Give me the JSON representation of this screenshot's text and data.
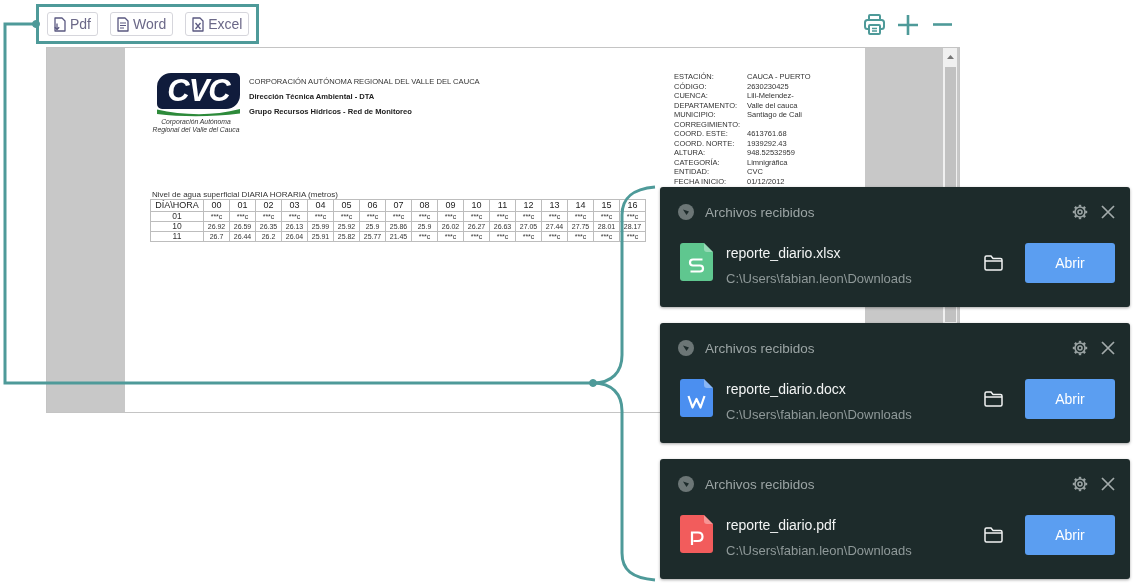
{
  "toolbar": {
    "buttons": [
      {
        "label": "Pdf",
        "kind": "pdf"
      },
      {
        "label": "Word",
        "kind": "word"
      },
      {
        "label": "Excel",
        "kind": "excel"
      }
    ]
  },
  "document": {
    "logo": {
      "wordmark": "CVC",
      "caption_lines": [
        "Corporación Autónoma",
        "Regional del Valle del Cauca"
      ]
    },
    "header_lines": [
      "CORPORACIÓN AUTÓNOMA REGIONAL DEL VALLE DEL CAUCA",
      "Dirección Técnica Ambiental - DTA",
      "Grupo Recursos Hídricos - Red de Monitoreo"
    ],
    "station_info": [
      {
        "label": "ESTACIÓN:",
        "value": "CAUCA - PUERTO"
      },
      {
        "label": "CÓDIGO:",
        "value": "2630230425"
      },
      {
        "label": "CUENCA:",
        "value": "Lili-Melendez-"
      },
      {
        "label": "DEPARTAMENTO:",
        "value": "Valle del cauca"
      },
      {
        "label": "MUNICIPIO:",
        "value": "Santiago de Cali"
      },
      {
        "label": "CORREGIMIENTO:"
      },
      {
        "label": "COORD. ESTE:",
        "value": "4613761.68"
      },
      {
        "label": "COORD. NORTE:",
        "value": "1939292.43"
      },
      {
        "label": "ALTURA:",
        "value": "948.52532959"
      },
      {
        "label": "CATEGORÍA:",
        "value": "Limnigráfica"
      },
      {
        "label": "ENTIDAD:",
        "value": "CVC"
      },
      {
        "label": "FECHA INICIO:",
        "value": "01/12/2012"
      }
    ],
    "table": {
      "caption": "Nivel de agua superficial DIARIA HORARIA (metros)",
      "columns": [
        "DÍA\\HORA",
        "00",
        "01",
        "02",
        "03",
        "04",
        "05",
        "06",
        "07",
        "08",
        "09",
        "10",
        "11",
        "12",
        "13",
        "14",
        "15",
        "16"
      ],
      "rows": [
        [
          "01",
          "***c",
          "***c",
          "***c",
          "***c",
          "***c",
          "***c",
          "***c",
          "***c",
          "***c",
          "***c",
          "***c",
          "***c",
          "***c",
          "***c",
          "***c",
          "***c",
          "***c"
        ],
        [
          "10",
          "26.92",
          "26.59",
          "26.35",
          "26.13",
          "25.99",
          "25.92",
          "25.9",
          "25.86",
          "25.9",
          "26.02",
          "26.27",
          "26.63",
          "27.05",
          "27.44",
          "27.75",
          "28.01",
          "28.17"
        ],
        [
          "11",
          "26.7",
          "26.44",
          "26.2",
          "26.04",
          "25.91",
          "25.82",
          "25.77",
          "21.45",
          "***c",
          "***c",
          "***c",
          "***c",
          "***c",
          "***c",
          "***c",
          "***c",
          "***c"
        ]
      ]
    }
  },
  "notifications": [
    {
      "title": "Archivos recibidos",
      "kind": "xlsx",
      "file_name": "reporte_diario.xlsx",
      "path": "C:\\Users\\fabian.leon\\Downloads",
      "button": "Abrir"
    },
    {
      "title": "Archivos recibidos",
      "kind": "docx",
      "file_name": "reporte_diario.docx",
      "path": "C:\\Users\\fabian.leon\\Downloads",
      "button": "Abrir"
    },
    {
      "title": "Archivos recibidos",
      "kind": "pdf",
      "file_name": "reporte_diario.pdf",
      "path": "C:\\Users\\fabian.leon\\Downloads",
      "button": "Abrir"
    }
  ]
}
